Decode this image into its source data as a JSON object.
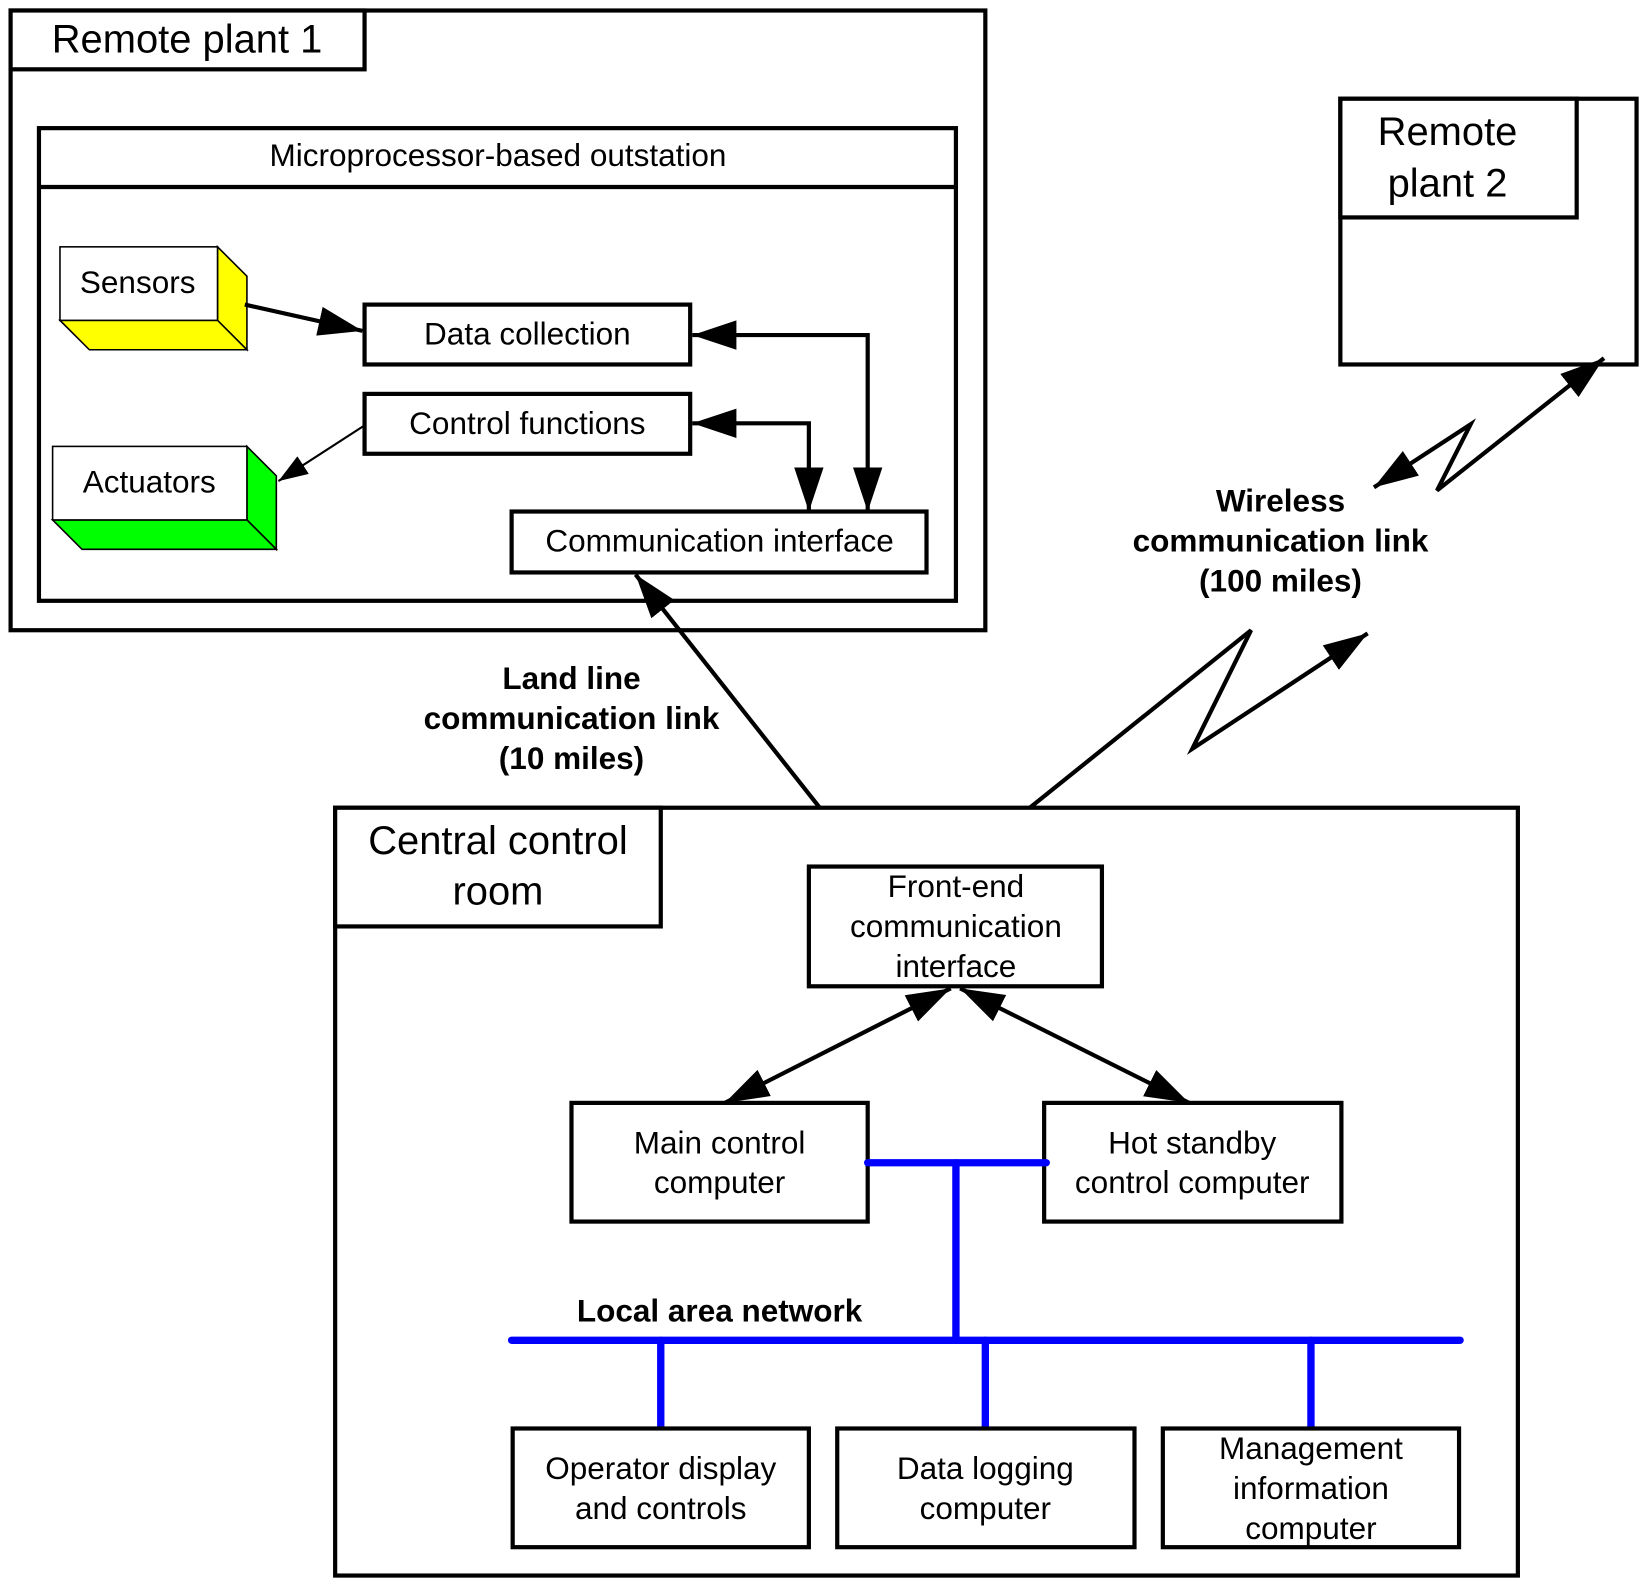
{
  "colors": {
    "sensors": "#ffff00",
    "actuators": "#00ff00",
    "lan": "#0000ff",
    "line": "#000000"
  },
  "remote_plant_1": {
    "title": "Remote plant 1",
    "outstation": {
      "title": "Microprocessor-based outstation",
      "sensors": "Sensors",
      "actuators": "Actuators",
      "data_collection": "Data collection",
      "control_functions": "Control functions",
      "communication_interface": "Communication interface"
    }
  },
  "remote_plant_2": {
    "title_lines": [
      "Remote",
      "plant 2"
    ]
  },
  "land_line": {
    "lines": [
      "Land line",
      "communication link",
      "(10 miles)"
    ]
  },
  "wireless": {
    "lines": [
      "Wireless",
      "communication link",
      "(100 miles)"
    ]
  },
  "central": {
    "title_lines": [
      "Central control",
      "room"
    ],
    "front_end": [
      "Front-end",
      "communication",
      "interface"
    ],
    "main_control": [
      "Main control",
      "computer"
    ],
    "hot_standby": [
      "Hot standby",
      "control computer"
    ],
    "lan_label": "Local area network",
    "operator": [
      "Operator display",
      "and controls"
    ],
    "data_logging": [
      "Data logging",
      "computer"
    ],
    "management": [
      "Management",
      "information",
      "computer"
    ]
  }
}
